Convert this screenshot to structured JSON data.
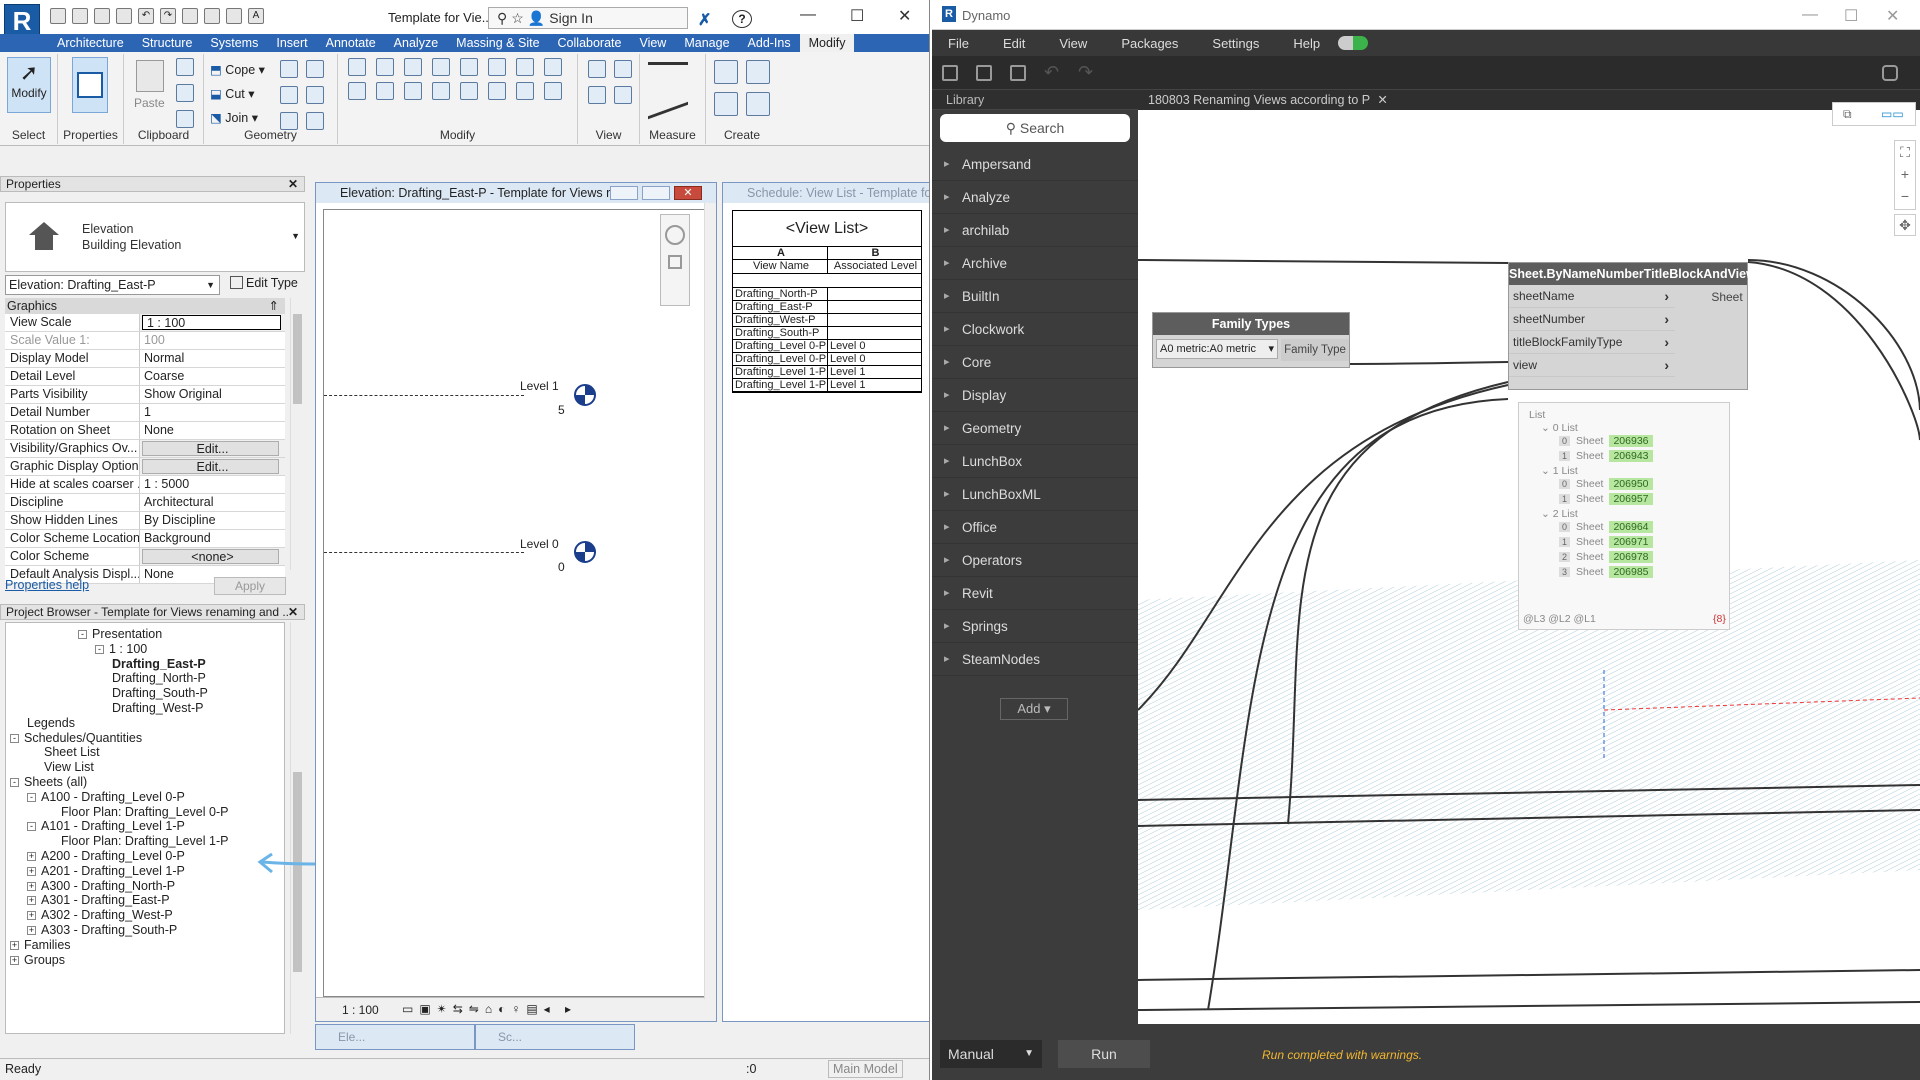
{
  "revit": {
    "logo": "R",
    "doc_title": "Template for Vie...",
    "signin": "Sign In",
    "tabs": [
      "Architecture",
      "Structure",
      "Systems",
      "Insert",
      "Annotate",
      "Analyze",
      "Massing & Site",
      "Collaborate",
      "View",
      "Manage",
      "Add-Ins",
      "Modify"
    ],
    "active_tab": "Modify",
    "ribbon": {
      "modify_label": "Modify",
      "paste_label": "Paste",
      "cope": "Cope",
      "cut": "Cut",
      "join": "Join",
      "panels": [
        "Select",
        "Properties",
        "Clipboard",
        "Geometry",
        "Modify",
        "View",
        "Measure",
        "Create"
      ]
    },
    "properties": {
      "header": "Properties",
      "type_line1": "Elevation",
      "type_line2": "Building Elevation",
      "instance": "Elevation: Drafting_East-P",
      "edit_type": "Edit Type",
      "group": "Graphics",
      "rows": [
        {
          "k": "View Scale",
          "v": "1 : 100",
          "style": "boxed"
        },
        {
          "k": "Scale Value    1:",
          "v": "100",
          "style": "grey"
        },
        {
          "k": "Display Model",
          "v": "Normal"
        },
        {
          "k": "Detail Level",
          "v": "Coarse"
        },
        {
          "k": "Parts Visibility",
          "v": "Show Original"
        },
        {
          "k": "Detail Number",
          "v": "1"
        },
        {
          "k": "Rotation on Sheet",
          "v": "None"
        },
        {
          "k": "Visibility/Graphics Ov...",
          "v": "Edit...",
          "style": "btn"
        },
        {
          "k": "Graphic Display Options",
          "v": "Edit...",
          "style": "btn"
        },
        {
          "k": "Hide at scales coarser ...",
          "v": "1 : 5000"
        },
        {
          "k": "Discipline",
          "v": "Architectural"
        },
        {
          "k": "Show Hidden Lines",
          "v": "By Discipline"
        },
        {
          "k": "Color Scheme Location",
          "v": "Background"
        },
        {
          "k": "Color Scheme",
          "v": "<none>",
          "style": "btn"
        },
        {
          "k": "Default Analysis Displ...",
          "v": "None"
        }
      ],
      "help": "Properties help",
      "apply": "Apply"
    },
    "browser": {
      "header": "Project Browser - Template for Views renaming and ...",
      "items": [
        {
          "t": "Presentation",
          "lvl": 4,
          "exp": "-"
        },
        {
          "t": "1 : 100",
          "lvl": 5,
          "exp": "-"
        },
        {
          "t": "Drafting_East-P",
          "lvl": 6,
          "bold": true
        },
        {
          "t": "Drafting_North-P",
          "lvl": 6
        },
        {
          "t": "Drafting_South-P",
          "lvl": 6
        },
        {
          "t": "Drafting_West-P",
          "lvl": 6
        },
        {
          "t": "Legends",
          "lvl": 1
        },
        {
          "t": "Schedules/Quantities",
          "lvl": 0,
          "exp": "-"
        },
        {
          "t": "Sheet List",
          "lvl": 2
        },
        {
          "t": "View List",
          "lvl": 2
        },
        {
          "t": "Sheets (all)",
          "lvl": 0,
          "exp": "-"
        },
        {
          "t": "A100 - Drafting_Level 0-P",
          "lvl": 1,
          "exp": "-"
        },
        {
          "t": "Floor Plan: Drafting_Level 0-P",
          "lvl": 3
        },
        {
          "t": "A101 - Drafting_Level 1-P",
          "lvl": 1,
          "exp": "-"
        },
        {
          "t": "Floor Plan: Drafting_Level 1-P",
          "lvl": 3
        },
        {
          "t": "A200 - Drafting_Level 0-P",
          "lvl": 1,
          "exp": "+"
        },
        {
          "t": "A201 - Drafting_Level 1-P",
          "lvl": 1,
          "exp": "+"
        },
        {
          "t": "A300 - Drafting_North-P",
          "lvl": 1,
          "exp": "+"
        },
        {
          "t": "A301 - Drafting_East-P",
          "lvl": 1,
          "exp": "+"
        },
        {
          "t": "A302 - Drafting_West-P",
          "lvl": 1,
          "exp": "+"
        },
        {
          "t": "A303 - Drafting_South-P",
          "lvl": 1,
          "exp": "+"
        },
        {
          "t": "Families",
          "lvl": 0,
          "exp": "+"
        },
        {
          "t": "Groups",
          "lvl": 0,
          "exp": "+"
        }
      ]
    },
    "elev_window": {
      "title": "Elevation: Drafting_East-P - Template for Views r...",
      "level1": "Level 1",
      "level1_val": "5",
      "level0": "Level 0",
      "level0_val": "0",
      "scale": "1 : 100"
    },
    "schedule_window": {
      "title": "Schedule: View List - Template for",
      "table_title": "<View List>",
      "col_a": "A",
      "col_b": "B",
      "h1": "View Name",
      "h2": "Associated Level",
      "rows": [
        [
          "Drafting_North-P",
          ""
        ],
        [
          "Drafting_East-P",
          ""
        ],
        [
          "Drafting_West-P",
          ""
        ],
        [
          "Drafting_South-P",
          ""
        ],
        [
          "Drafting_Level 0-P",
          "Level 0"
        ],
        [
          "Drafting_Level 0-P",
          "Level 0"
        ],
        [
          "Drafting_Level 1-P",
          "Level 1"
        ],
        [
          "Drafting_Level 1-P",
          "Level 1"
        ]
      ]
    },
    "minimized": [
      "Ele...",
      "Sc..."
    ],
    "status": "Ready",
    "status_zero": ":0",
    "main_model": "Main Model"
  },
  "dynamo": {
    "title": "Dynamo",
    "menu": [
      "File",
      "Edit",
      "View",
      "Packages",
      "Settings",
      "Help"
    ],
    "library_label": "Library",
    "search": "Search",
    "library": [
      "Ampersand",
      "Analyze",
      "archilab",
      "Archive",
      "BuiltIn",
      "Clockwork",
      "Core",
      "Display",
      "Geometry",
      "LunchBox",
      "LunchBoxML",
      "Office",
      "Operators",
      "Revit",
      "Springs",
      "SteamNodes"
    ],
    "add": "Add",
    "workspace_tab": "180803 Renaming Views according to P",
    "family_node": {
      "title": "Family Types",
      "value": "A0 metric:A0 metric",
      "output": "Family Type"
    },
    "sheet_node": {
      "title": "Sheet.ByNameNumberTitleBlockAndView",
      "inputs": [
        "sheetName",
        "sheetNumber",
        "titleBlockFamilyType",
        "view"
      ],
      "output": "Sheet"
    },
    "preview": {
      "root": "List",
      "groups": [
        {
          "label": "0 List",
          "items": [
            [
              "0",
              "Sheet",
              "206936"
            ],
            [
              "1",
              "Sheet",
              "206943"
            ]
          ]
        },
        {
          "label": "1 List",
          "items": [
            [
              "0",
              "Sheet",
              "206950"
            ],
            [
              "1",
              "Sheet",
              "206957"
            ]
          ]
        },
        {
          "label": "2 List",
          "items": [
            [
              "0",
              "Sheet",
              "206964"
            ],
            [
              "1",
              "Sheet",
              "206971"
            ],
            [
              "2",
              "Sheet",
              "206978"
            ],
            [
              "3",
              "Sheet",
              "206985"
            ]
          ]
        }
      ],
      "footer": "@L3 @L2 @L1",
      "count": "{8}"
    },
    "run_mode": "Manual",
    "run": "Run",
    "run_status": "Run completed with warnings."
  }
}
